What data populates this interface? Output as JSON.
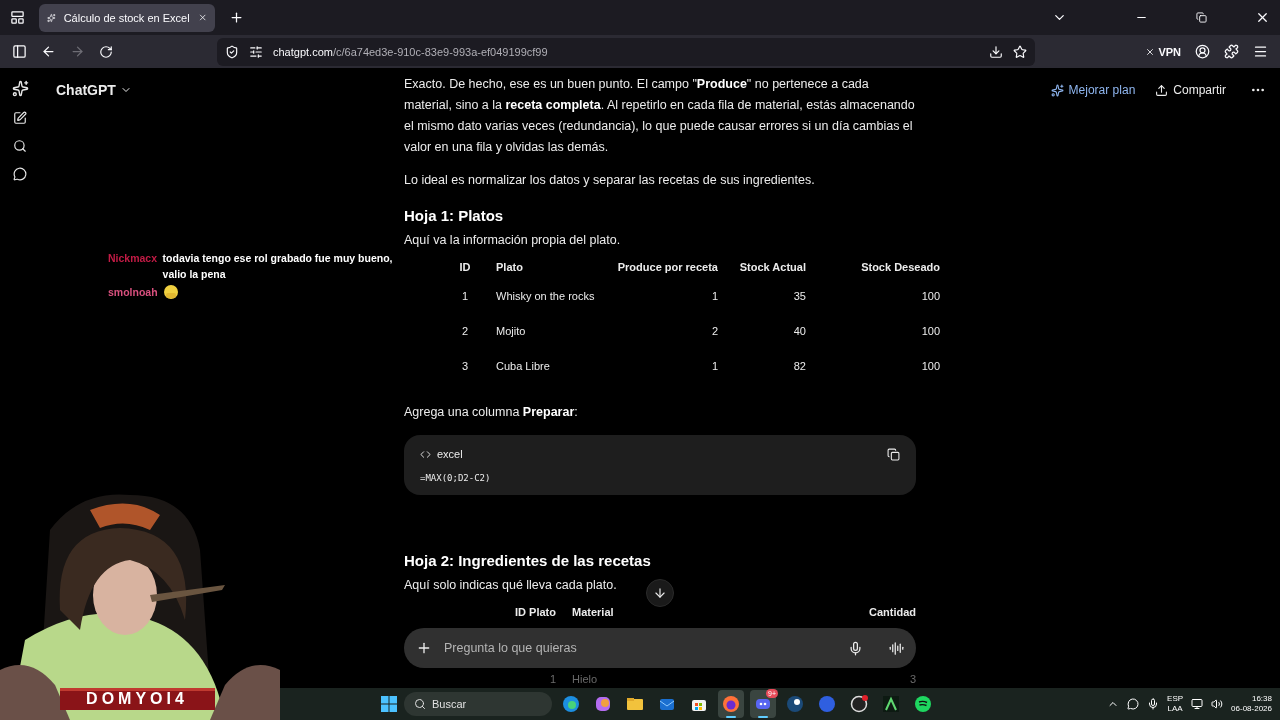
{
  "browser": {
    "tabs": [
      {
        "title": "Cálculo de stock en Excel",
        "selected": true
      }
    ],
    "url": {
      "domain": "chatgpt.com",
      "path": "/c/6a74ed3e-910c-83e9-993a-ef049199cf99"
    },
    "forward_disabled": true,
    "vpn_label": "VPN"
  },
  "chatgpt": {
    "model": "ChatGPT",
    "actions": [
      {
        "kind": "upgrade",
        "label": "Mejorar plan"
      },
      {
        "kind": "share",
        "label": "Compartir"
      }
    ]
  },
  "content": [
    {
      "kind": "paragraph",
      "text": "Exacto. De hecho, ese es un buen punto. El campo \"**Produce**\" no pertenece a cada material, sino a la **receta completa**. Al repetirlo en cada fila de material, estás almacenando el mismo dato varias veces (redundancia), lo que puede causar errores si un día cambias el valor en una fila y olvidas las demás."
    },
    {
      "kind": "paragraph",
      "text": "Lo ideal es normalizar los datos y separar las recetas de sus ingredientes."
    },
    {
      "kind": "heading",
      "text": "Hoja 1: Platos"
    },
    {
      "kind": "paragraph",
      "text": "Aquí va la información propia del plato."
    },
    {
      "kind": "table",
      "columns": [
        "ID",
        "Plato",
        "Produce por receta",
        "Stock Actual",
        "Stock Deseado"
      ],
      "rows": [
        [
          "1",
          "Whisky on the rocks",
          "1",
          "35",
          "100"
        ],
        [
          "2",
          "Mojito",
          "2",
          "40",
          "100"
        ],
        [
          "3",
          "Cuba Libre",
          "1",
          "82",
          "100"
        ]
      ]
    },
    {
      "kind": "paragraph",
      "text": "Agrega una columna **Preparar**:"
    },
    {
      "kind": "code",
      "language": "excel",
      "code": "=MAX(0;D2-C2)"
    },
    {
      "kind": "heading",
      "text": "Hoja 2: Ingredientes de las recetas"
    },
    {
      "kind": "paragraph",
      "text": "Aquí solo indicas qué lleva cada plato."
    },
    {
      "kind": "table",
      "columns": [
        "ID Plato",
        "Material",
        "Cantidad"
      ],
      "rows": [
        [
          "1",
          "Hielo",
          "3"
        ]
      ]
    }
  ],
  "composer": {
    "placeholder": "Pregunta lo que quieras"
  },
  "stream_chat": [
    {
      "user": "Nickmacx",
      "color": "#c21b45",
      "kind": "text",
      "message": "todavia tengo ese rol grabado fue muy bueno, valio la pena"
    },
    {
      "user": "smolnoah",
      "color": "#d9507e",
      "kind": "emote"
    }
  ],
  "overlay": {
    "name": "DOMYOI4"
  },
  "taskbar": {
    "search_placeholder": "Buscar",
    "apps": [
      {
        "kind": "edge",
        "active": false
      },
      {
        "kind": "copilot",
        "active": false
      },
      {
        "kind": "folder",
        "active": false
      },
      {
        "kind": "mail",
        "active": false
      },
      {
        "kind": "store",
        "active": false
      },
      {
        "kind": "firefox",
        "active": true
      },
      {
        "kind": "discord",
        "active": true,
        "badge": "9+"
      },
      {
        "kind": "steam",
        "active": false
      },
      {
        "kind": "ea",
        "active": false
      },
      {
        "kind": "obs",
        "active": false
      },
      {
        "kind": "app",
        "active": false
      },
      {
        "kind": "spotify",
        "active": false
      }
    ],
    "language": "ESP",
    "layout": "LAA",
    "time": "16:38",
    "date": "06-08-2026"
  }
}
